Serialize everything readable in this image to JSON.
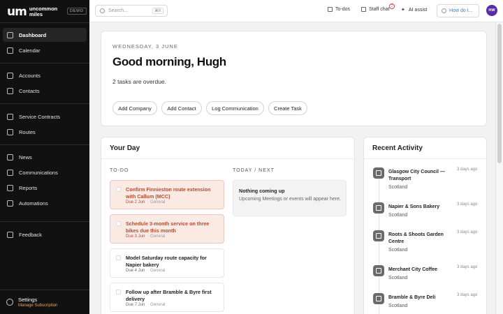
{
  "app": {
    "logo_mark": "um",
    "logo_text_1": "uncommon",
    "logo_text_2": "miles",
    "env_badge": "DEMO"
  },
  "sidebar": {
    "groups": [
      [
        {
          "label": "Dashboard",
          "icon": "dashboard-icon",
          "active": true
        },
        {
          "label": "Calendar",
          "icon": "calendar-icon"
        }
      ],
      [
        {
          "label": "Accounts",
          "icon": "building-icon"
        },
        {
          "label": "Contacts",
          "icon": "contact-icon"
        }
      ],
      [
        {
          "label": "Service Contracts",
          "icon": "document-icon"
        },
        {
          "label": "Routes",
          "icon": "route-icon"
        }
      ],
      [
        {
          "label": "News",
          "icon": "news-icon"
        },
        {
          "label": "Communications",
          "icon": "chat-icon"
        },
        {
          "label": "Reports",
          "icon": "chart-icon"
        },
        {
          "label": "Automations",
          "icon": "lightning-icon"
        }
      ],
      [
        {
          "label": "Feedback",
          "icon": "feedback-icon"
        }
      ]
    ],
    "settings": {
      "title": "Settings",
      "subtitle": "Manage Subscription"
    }
  },
  "topbar": {
    "search_placeholder": "Search...",
    "search_shortcut": "⌘K",
    "todos_label": "To-dos",
    "staff_chat_label": "Staff chat",
    "staff_chat_count": "7",
    "ai_assist_label": "AI assist",
    "help_label": "How do I...",
    "avatar_initials": "HW"
  },
  "greeting": {
    "date": "WEDNESDAY, 3 JUNE",
    "title": "Good morning, Hugh",
    "overdue": "2 tasks are overdue.",
    "actions": [
      "Add Company",
      "Add Contact",
      "Log Communication",
      "Create Task"
    ]
  },
  "your_day": {
    "title": "Your Day",
    "todo_header": "TO-DO",
    "next_header": "TODAY / NEXT",
    "tasks": [
      {
        "title": "Confirm Finnieston route extension with Callum (MCC)",
        "due": "Due 2 Jun",
        "tag": "General",
        "overdue": true
      },
      {
        "title": "Schedule 3-month service on three bikes due this month",
        "due": "Due 3 Jun",
        "tag": "General",
        "overdue": true
      },
      {
        "title": "Model Saturday route capacity for Napier bakery",
        "due": "Due 4 Jun",
        "tag": "General",
        "overdue": false
      },
      {
        "title": "Follow up after Bramble & Byre first delivery",
        "due": "Due 7 Jun",
        "tag": "General",
        "overdue": false
      }
    ],
    "empty_title": "Nothing coming up",
    "empty_text": "Upcoming Meetings or events will appear here."
  },
  "recent_activity": {
    "title": "Recent Activity",
    "items": [
      {
        "name": "Glasgow City Council — Transport",
        "location": "Scotland",
        "time": "3 days ago"
      },
      {
        "name": "Napier & Sons Bakery",
        "location": "Scotland",
        "time": "3 days ago"
      },
      {
        "name": "Roots & Shoots Garden Centre",
        "location": "Scotland",
        "time": "3 days ago"
      },
      {
        "name": "Merchant City Coffee",
        "location": "Scotland",
        "time": "3 days ago"
      },
      {
        "name": "Bramble & Byre Deli",
        "location": "Scotland",
        "time": "3 days ago"
      }
    ]
  },
  "colors": {
    "sidebar_bg": "#111111",
    "overdue_text": "#b84a2e",
    "overdue_bg": "#fbe9e4",
    "accent_orange": "#f0a35a",
    "avatar_bg": "#5a2aa8"
  }
}
